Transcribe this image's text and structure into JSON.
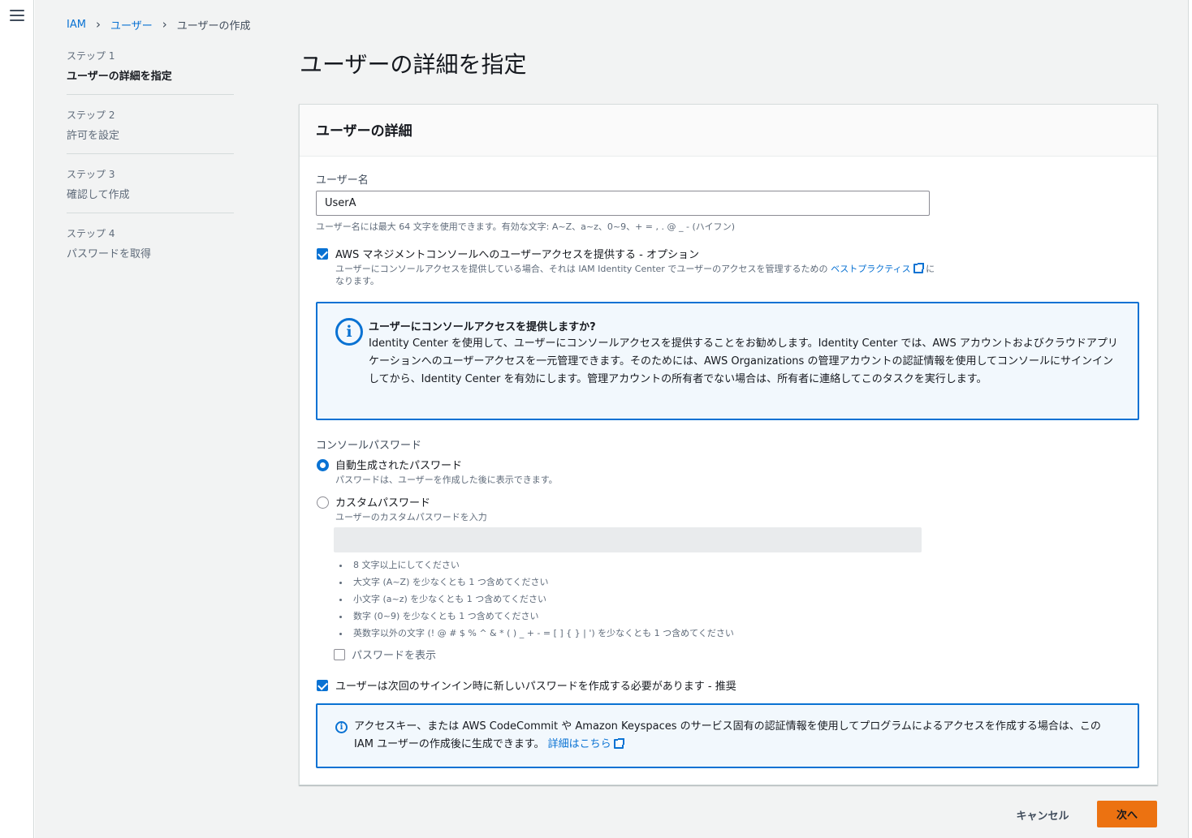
{
  "breadcrumb": {
    "items": [
      "IAM",
      "ユーザー"
    ],
    "current": "ユーザーの作成"
  },
  "steps": [
    {
      "num": "ステップ 1",
      "name": "ユーザーの詳細を指定"
    },
    {
      "num": "ステップ 2",
      "name": "許可を設定"
    },
    {
      "num": "ステップ 3",
      "name": "確認して作成"
    },
    {
      "num": "ステップ 4",
      "name": "パスワードを取得"
    }
  ],
  "page_title": "ユーザーの詳細を指定",
  "panel": {
    "title": "ユーザーの詳細",
    "username_label": "ユーザー名",
    "username_value": "UserA",
    "username_hint": "ユーザー名には最大 64 文字を使用できます。有効な文字: A~Z、a~z、0~9、+ = , . @ _ - (ハイフン)",
    "console_access": {
      "checked": true,
      "label": "AWS マネジメントコンソールへのユーザーアクセスを提供する - オプション",
      "desc_before": "ユーザーにコンソールアクセスを提供している場合、それは IAM Identity Center でユーザーのアクセスを管理するための",
      "desc_link": "ベストプラクティス",
      "desc_after": "になります。"
    },
    "alert": {
      "title": "ユーザーにコンソールアクセスを提供しますか?",
      "body": "Identity Center を使用して、ユーザーにコンソールアクセスを提供することをお勧めします。Identity Center では、AWS アカウントおよびクラウドアプリケーションへのユーザーアクセスを一元管理できます。そのためには、AWS Organizations の管理アカウントの認証情報を使用してコンソールにサインインしてから、Identity Center を有効にします。管理アカウントの所有者でない場合は、所有者に連絡してこのタスクを実行します。"
    },
    "password_label": "コンソールパスワード",
    "options": [
      {
        "label": "自動生成されたパスワード",
        "desc": "パスワードは、ユーザーを作成した後に表示できます。",
        "selected": true
      },
      {
        "label": "カスタムパスワード",
        "desc": "ユーザーのカスタムパスワードを入力",
        "selected": false
      }
    ],
    "requirements": [
      "8 文字以上にしてください",
      "大文字 (A~Z) を少なくとも 1 つ含めてください",
      "小文字 (a~z) を少なくとも 1 つ含めてください",
      "数字 (0~9) を少なくとも 1 つ含めてください",
      "英数字以外の文字 (! @ # $ % ^ & * ( ) _ + - = [ ] { } | ') を少なくとも 1 つ含めてください"
    ],
    "show_password_label": "パスワードを表示",
    "reset_required": {
      "checked": true,
      "label": "ユーザーは次回のサインイン時に新しいパスワードを作成する必要があります - 推奨"
    },
    "info_box": {
      "text": "アクセスキー、または AWS CodeCommit や Amazon Keyspaces のサービス固有の認証情報を使用してプログラムによるアクセスを作成する場合は、この IAM ユーザーの作成後に生成できます。",
      "link": "詳細はこちら"
    }
  },
  "buttons": {
    "cancel": "キャンセル",
    "next": "次へ"
  },
  "icons": {
    "menu": "hamburger-icon",
    "info": "info-icon",
    "external": "external-link-icon"
  },
  "colors": {
    "accent": "#0972d3",
    "primary_button": "#ec7211",
    "background": "#f2f3f3"
  }
}
